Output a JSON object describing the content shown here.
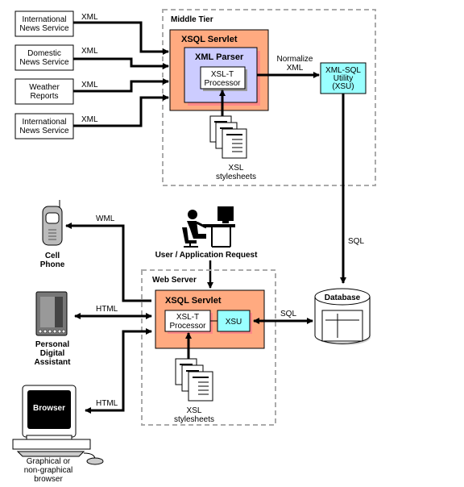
{
  "middle_tier": {
    "label": "Middle Tier",
    "servlet_label": "XSQL Servlet",
    "parser_label": "XML Parser",
    "processor_line1": "XSL-T",
    "processor_line2": "Processor",
    "stylesheets_line1": "XSL",
    "stylesheets_line2": "stylesheets",
    "normalize_line1": "Normalize",
    "normalize_line2": "XML",
    "xsu_line1": "XML-SQL",
    "xsu_line2": "Utility",
    "xsu_line3": "(XSU)"
  },
  "sources": [
    {
      "line1": "International",
      "line2": "News Service",
      "arrow_label": "XML"
    },
    {
      "line1": "Domestic",
      "line2": "News Service",
      "arrow_label": "XML"
    },
    {
      "line1": "Weather",
      "line2": "Reports",
      "arrow_label": "XML"
    },
    {
      "line1": "International",
      "line2": "News Service",
      "arrow_label": "XML"
    }
  ],
  "sql_vertical_label": "SQL",
  "user_request_label": "User / Application Request",
  "web_server": {
    "label": "Web Server",
    "servlet_label": "XSQL Servlet",
    "processor_line1": "XSL-T",
    "processor_line2": "Processor",
    "xsu_label": "XSU",
    "stylesheets_line1": "XSL",
    "stylesheets_line2": "stylesheets",
    "sql_label": "SQL"
  },
  "database_label": "Database",
  "clients": [
    {
      "line1": "Cell",
      "line2": "Phone",
      "line3": "",
      "arrow_label": "WML"
    },
    {
      "line1": "Personal",
      "line2": "Digital",
      "line3": "Assistant",
      "arrow_label": "HTML"
    },
    {
      "line1": "Graphical or",
      "line2": "non-graphical",
      "line3": "browser",
      "arrow_label": "HTML",
      "screen_label": "Browser"
    }
  ],
  "colors": {
    "servlet": "#FFAA80",
    "parser": "#CCCCFF",
    "xsu": "#99FFFF",
    "shadow": "#FF8888",
    "dashed_border": "#AAAAAA"
  }
}
